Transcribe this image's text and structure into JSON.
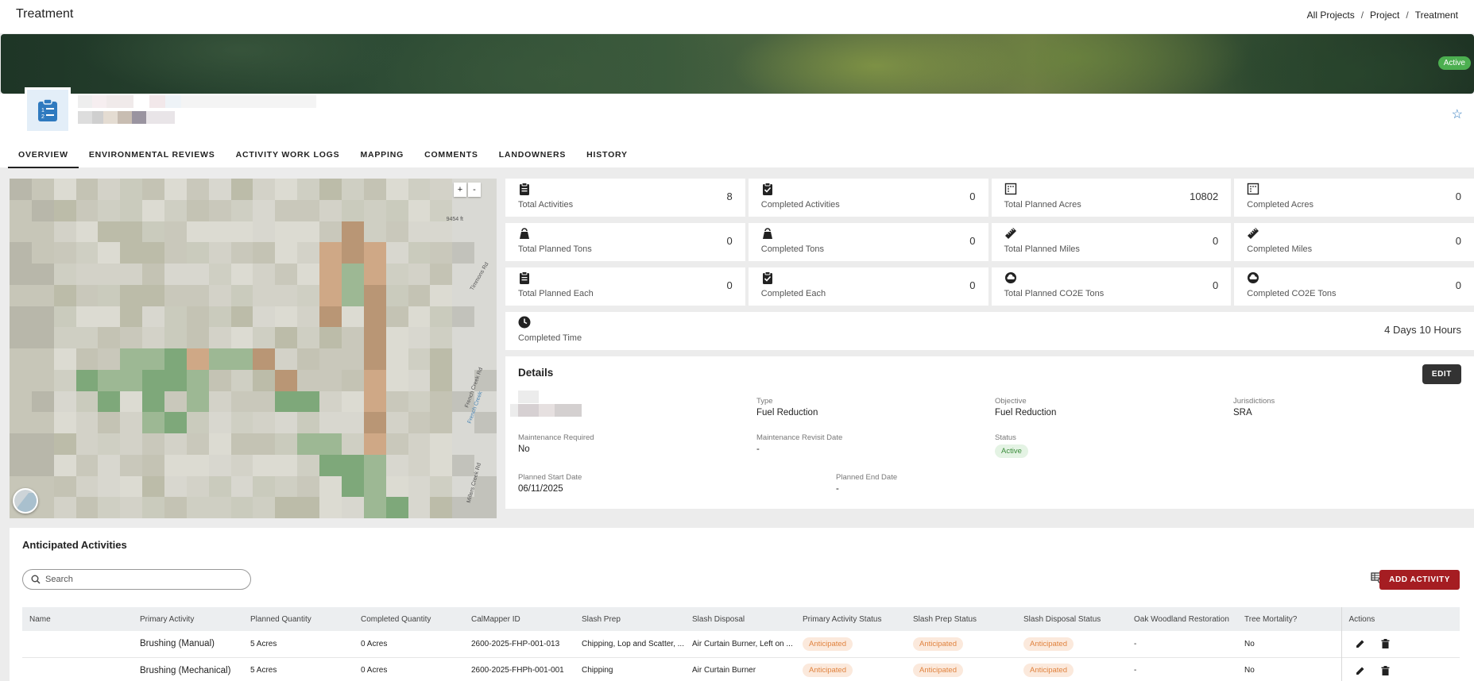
{
  "header": {
    "title": "Treatment",
    "breadcrumb": [
      "All Projects",
      "Project",
      "Treatment"
    ],
    "separator": "/"
  },
  "banner": {
    "status_badge": "Active"
  },
  "tabs": [
    {
      "label": "OVERVIEW",
      "active": true
    },
    {
      "label": "ENVIRONMENTAL REVIEWS"
    },
    {
      "label": "ACTIVITY WORK LOGS"
    },
    {
      "label": "MAPPING"
    },
    {
      "label": "COMMENTS"
    },
    {
      "label": "LANDOWNERS"
    },
    {
      "label": "HISTORY"
    }
  ],
  "map": {
    "zoom_in": "+",
    "zoom_out": "-",
    "labels": [
      "9454 ft",
      "Timmons Rd",
      "French Creek Rd",
      "French Creek",
      "Millers Creek Rd"
    ]
  },
  "stats": {
    "row1": [
      {
        "label": "Total Activities",
        "value": "8",
        "icon": "clipboard-icon"
      },
      {
        "label": "Completed Activities",
        "value": "0",
        "icon": "clipboard-check-icon"
      },
      {
        "label": "Total Planned Acres",
        "value": "10802",
        "icon": "acres-icon"
      },
      {
        "label": "Completed Acres",
        "value": "0",
        "icon": "acres-icon"
      }
    ],
    "row2": [
      {
        "label": "Total Planned Tons",
        "value": "0",
        "icon": "weight-icon"
      },
      {
        "label": "Completed Tons",
        "value": "0",
        "icon": "weight-icon"
      },
      {
        "label": "Total Planned Miles",
        "value": "0",
        "icon": "ruler-icon"
      },
      {
        "label": "Completed Miles",
        "value": "0",
        "icon": "ruler-icon"
      }
    ],
    "row3": [
      {
        "label": "Total Planned Each",
        "value": "0",
        "icon": "clipboard-icon"
      },
      {
        "label": "Completed Each",
        "value": "0",
        "icon": "clipboard-check-icon"
      },
      {
        "label": "Total Planned CO2E Tons",
        "value": "0",
        "icon": "cloud-icon"
      },
      {
        "label": "Completed CO2E Tons",
        "value": "0",
        "icon": "cloud-icon"
      }
    ],
    "time": {
      "label": "Completed Time",
      "value": "4 Days 10 Hours",
      "icon": "clock-icon"
    }
  },
  "details": {
    "title": "Details",
    "edit_label": "EDIT",
    "type_label": "Type",
    "type_value": "Fuel Reduction",
    "objective_label": "Objective",
    "objective_value": "Fuel Reduction",
    "jurisdictions_label": "Jurisdictions",
    "jurisdictions_value": "SRA",
    "maintenance_label": "Maintenance Required",
    "maintenance_value": "No",
    "revisit_label": "Maintenance Revisit Date",
    "revisit_value": "-",
    "status_label": "Status",
    "status_value": "Active",
    "start_label": "Planned Start Date",
    "start_value": "06/11/2025",
    "end_label": "Planned End Date",
    "end_value": "-"
  },
  "activities": {
    "title": "Anticipated Activities",
    "search_placeholder": "Search",
    "add_label": "ADD ACTIVITY",
    "columns": [
      "Name",
      "Primary Activity",
      "Planned Quantity",
      "Completed Quantity",
      "CalMapper ID",
      "Slash Prep",
      "Slash Disposal",
      "Primary Activity Status",
      "Slash Prep Status",
      "Slash Disposal Status",
      "Oak Woodland Restoration",
      "Tree Mortality?",
      "Actions"
    ],
    "rows": [
      {
        "name": "",
        "primary": "Brushing (Manual)",
        "planned": "5 Acres",
        "completed": "0 Acres",
        "calmapper": "2600-2025-FHP-001-013",
        "slash_prep": "Chipping, Lop and Scatter, ...",
        "slash_disposal": "Air Curtain Burner, Left on ...",
        "primary_status": "Anticipated",
        "prep_status": "Anticipated",
        "disposal_status": "Anticipated",
        "oak": "-",
        "mortality": "No"
      },
      {
        "name": "",
        "primary": "Brushing (Mechanical)",
        "planned": "5 Acres",
        "completed": "0 Acres",
        "calmapper": "2600-2025-FHPh-001-001",
        "slash_prep": "Chipping",
        "slash_disposal": "Air Curtain Burner",
        "primary_status": "Anticipated",
        "prep_status": "Anticipated",
        "disposal_status": "Anticipated",
        "oak": "-",
        "mortality": "No"
      }
    ]
  },
  "colors": {
    "accent_red": "#a51d22",
    "active_green": "#4caf50",
    "anticipated_orange": "#e0833f",
    "star_blue": "#2f7abf"
  }
}
